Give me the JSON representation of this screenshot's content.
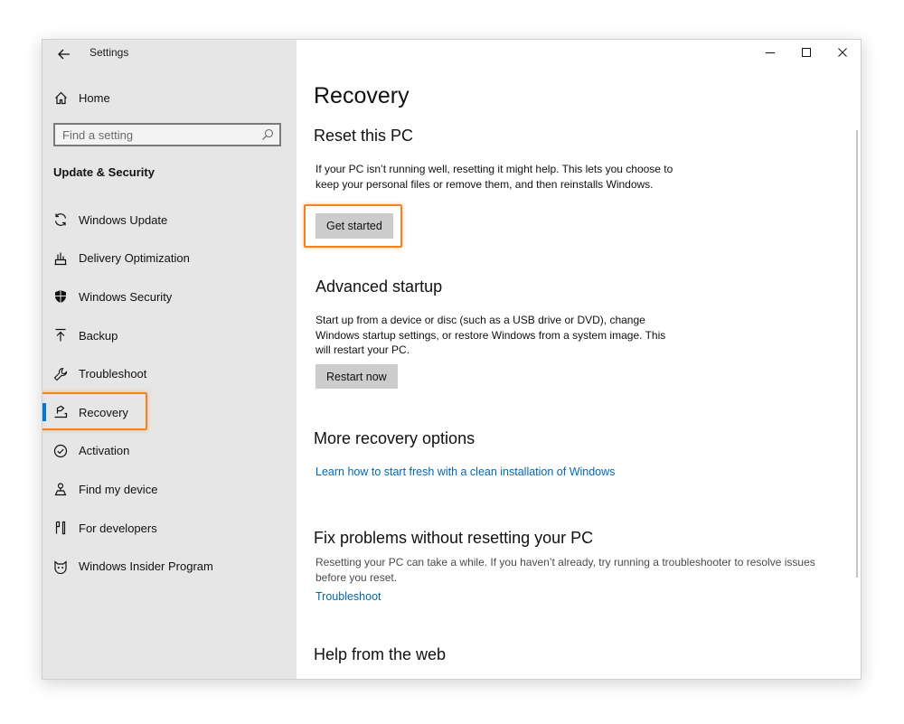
{
  "window": {
    "title": "Settings"
  },
  "sidebar": {
    "home_label": "Home",
    "search_placeholder": "Find a setting",
    "section_title": "Update & Security",
    "items": [
      {
        "label": "Windows Update",
        "icon": "sync-icon"
      },
      {
        "label": "Delivery Optimization",
        "icon": "delivery-optimization-icon"
      },
      {
        "label": "Windows Security",
        "icon": "shield-icon"
      },
      {
        "label": "Backup",
        "icon": "backup-arrow-icon"
      },
      {
        "label": "Troubleshoot",
        "icon": "wrench-icon"
      },
      {
        "label": "Recovery",
        "icon": "recovery-icon",
        "selected": true
      },
      {
        "label": "Activation",
        "icon": "checkmark-circle-icon"
      },
      {
        "label": "Find my device",
        "icon": "find-device-icon"
      },
      {
        "label": "For developers",
        "icon": "developer-tools-icon"
      },
      {
        "label": "Windows Insider Program",
        "icon": "insider-cat-icon"
      }
    ]
  },
  "main": {
    "page_title": "Recovery",
    "reset": {
      "heading": "Reset this PC",
      "description": "If your PC isn’t running well, resetting it might help. This lets you choose to keep your personal files or remove them, and then reinstalls Windows.",
      "button_label": "Get started"
    },
    "advanced": {
      "heading": "Advanced startup",
      "description": "Start up from a device or disc (such as a USB drive or DVD), change Windows startup settings, or restore Windows from a system image. This will restart your PC.",
      "button_label": "Restart now"
    },
    "more": {
      "heading": "More recovery options",
      "link_label": "Learn how to start fresh with a clean installation of Windows"
    },
    "fix": {
      "heading": "Fix problems without resetting your PC",
      "description": "Resetting your PC can take a while. If you haven’t already, try running a troubleshooter to resolve issues before you reset.",
      "link_label": "Troubleshoot"
    },
    "help": {
      "heading": "Help from the web"
    }
  },
  "colors": {
    "accent": "#0078d7",
    "link": "#0067b8",
    "highlight": "#f5821f",
    "sidebar_bg": "#e6e6e6",
    "button_bg": "#cccccc"
  }
}
